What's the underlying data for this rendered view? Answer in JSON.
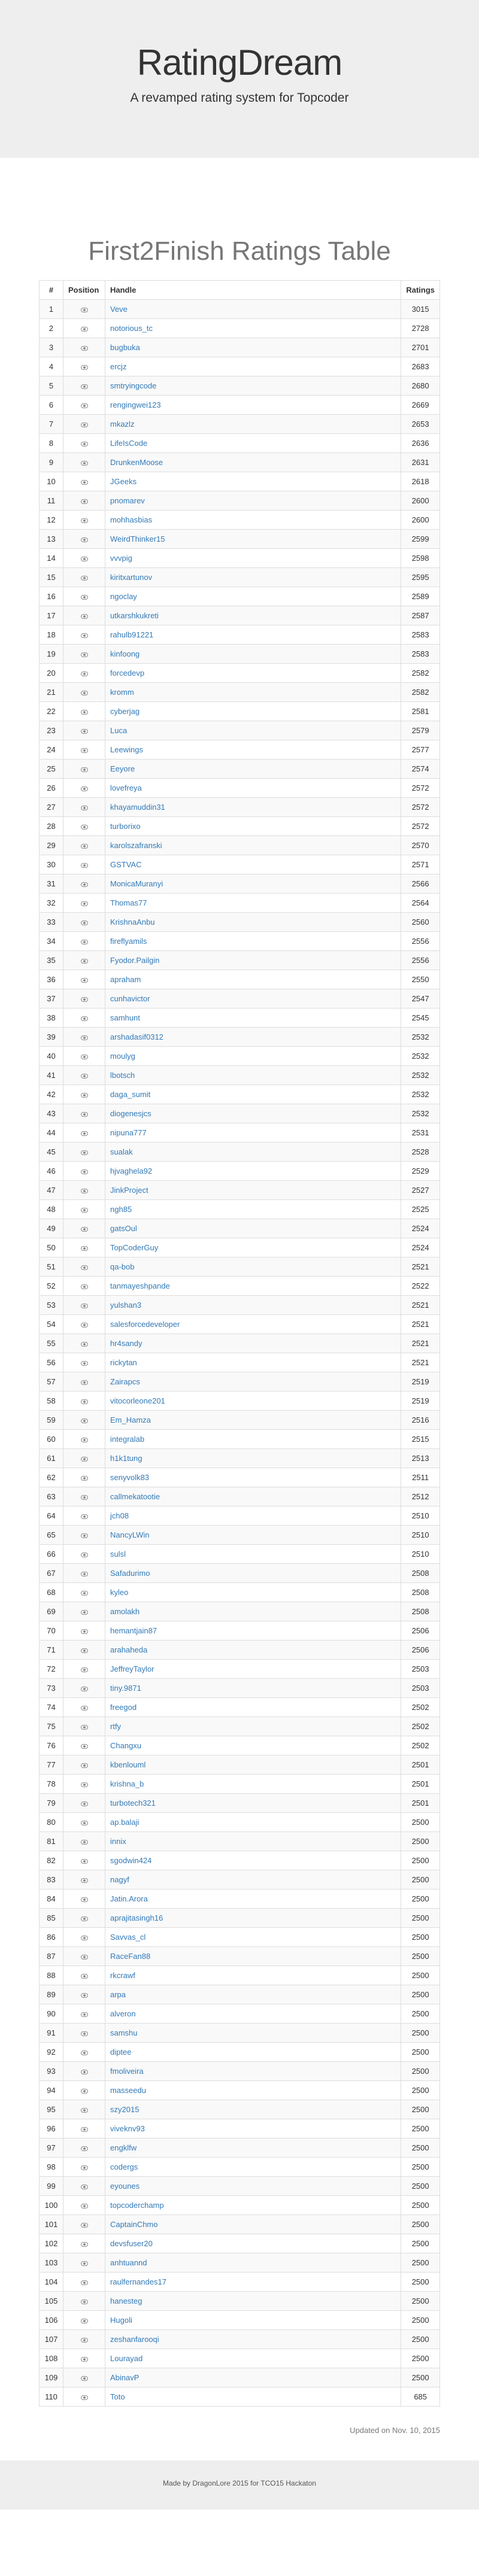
{
  "header": {
    "title": "RatingDream",
    "subtitle": "A revamped rating system for Topcoder"
  },
  "table": {
    "title": "First2Finish Ratings Table",
    "columns": [
      "#",
      "Position",
      "Handle",
      "Ratings"
    ],
    "rows": [
      {
        "n": "1",
        "handle": "Veve",
        "rating": "3015"
      },
      {
        "n": "2",
        "handle": "notorious_tc",
        "rating": "2728"
      },
      {
        "n": "3",
        "handle": "bugbuka",
        "rating": "2701"
      },
      {
        "n": "4",
        "handle": "ercjz",
        "rating": "2683"
      },
      {
        "n": "5",
        "handle": "smtryingcode",
        "rating": "2680"
      },
      {
        "n": "6",
        "handle": "rengingwei123",
        "rating": "2669"
      },
      {
        "n": "7",
        "handle": "mkazlz",
        "rating": "2653"
      },
      {
        "n": "8",
        "handle": "LifeIsCode",
        "rating": "2636"
      },
      {
        "n": "9",
        "handle": "DrunkenMoose",
        "rating": "2631"
      },
      {
        "n": "10",
        "handle": "JGeeks",
        "rating": "2618"
      },
      {
        "n": "11",
        "handle": "pnomarev",
        "rating": "2600"
      },
      {
        "n": "12",
        "handle": "mohhasbias",
        "rating": "2600"
      },
      {
        "n": "13",
        "handle": "WeirdThinker15",
        "rating": "2599"
      },
      {
        "n": "14",
        "handle": "vvvpig",
        "rating": "2598"
      },
      {
        "n": "15",
        "handle": "kiritxartunov",
        "rating": "2595"
      },
      {
        "n": "16",
        "handle": "ngoclay",
        "rating": "2589"
      },
      {
        "n": "17",
        "handle": "utkarshkukreti",
        "rating": "2587"
      },
      {
        "n": "18",
        "handle": "rahulb91221",
        "rating": "2583"
      },
      {
        "n": "19",
        "handle": "kinfoong",
        "rating": "2583"
      },
      {
        "n": "20",
        "handle": "forcedevp",
        "rating": "2582"
      },
      {
        "n": "21",
        "handle": "kromm",
        "rating": "2582"
      },
      {
        "n": "22",
        "handle": "cyberjag",
        "rating": "2581"
      },
      {
        "n": "23",
        "handle": "Luca",
        "rating": "2579"
      },
      {
        "n": "24",
        "handle": "Leewings",
        "rating": "2577"
      },
      {
        "n": "25",
        "handle": "Eeyore",
        "rating": "2574"
      },
      {
        "n": "26",
        "handle": "lovefreya",
        "rating": "2572"
      },
      {
        "n": "27",
        "handle": "khayamuddin31",
        "rating": "2572"
      },
      {
        "n": "28",
        "handle": "turborixo",
        "rating": "2572"
      },
      {
        "n": "29",
        "handle": "karolszafranski",
        "rating": "2570"
      },
      {
        "n": "30",
        "handle": "GSTVAC",
        "rating": "2571"
      },
      {
        "n": "31",
        "handle": "MonicaMuranyi",
        "rating": "2566"
      },
      {
        "n": "32",
        "handle": "Thomas77",
        "rating": "2564"
      },
      {
        "n": "33",
        "handle": "KrishnaAnbu",
        "rating": "2560"
      },
      {
        "n": "34",
        "handle": "fireflyamils",
        "rating": "2556"
      },
      {
        "n": "35",
        "handle": "Fyodor.Pailgin",
        "rating": "2556"
      },
      {
        "n": "36",
        "handle": "apraham",
        "rating": "2550"
      },
      {
        "n": "37",
        "handle": "cunhavictor",
        "rating": "2547"
      },
      {
        "n": "38",
        "handle": "samhunt",
        "rating": "2545"
      },
      {
        "n": "39",
        "handle": "arshadasif0312",
        "rating": "2532"
      },
      {
        "n": "40",
        "handle": "moulyg",
        "rating": "2532"
      },
      {
        "n": "41",
        "handle": "lbotsch",
        "rating": "2532"
      },
      {
        "n": "42",
        "handle": "daga_sumit",
        "rating": "2532"
      },
      {
        "n": "43",
        "handle": "diogenesjcs",
        "rating": "2532"
      },
      {
        "n": "44",
        "handle": "nipuna777",
        "rating": "2531"
      },
      {
        "n": "45",
        "handle": "sualak",
        "rating": "2528"
      },
      {
        "n": "46",
        "handle": "hjvaghela92",
        "rating": "2529"
      },
      {
        "n": "47",
        "handle": "JinkProject",
        "rating": "2527"
      },
      {
        "n": "48",
        "handle": "ngh85",
        "rating": "2525"
      },
      {
        "n": "49",
        "handle": "gatsOul",
        "rating": "2524"
      },
      {
        "n": "50",
        "handle": "TopCoderGuy",
        "rating": "2524"
      },
      {
        "n": "51",
        "handle": "qa-bob",
        "rating": "2521"
      },
      {
        "n": "52",
        "handle": "tanmayeshpande",
        "rating": "2522"
      },
      {
        "n": "53",
        "handle": "yulshan3",
        "rating": "2521"
      },
      {
        "n": "54",
        "handle": "salesforcedeveloper",
        "rating": "2521"
      },
      {
        "n": "55",
        "handle": "hr4sandy",
        "rating": "2521"
      },
      {
        "n": "56",
        "handle": "rickytan",
        "rating": "2521"
      },
      {
        "n": "57",
        "handle": "Zairapcs",
        "rating": "2519"
      },
      {
        "n": "58",
        "handle": "vitocorleone201",
        "rating": "2519"
      },
      {
        "n": "59",
        "handle": "Em_Hamza",
        "rating": "2516"
      },
      {
        "n": "60",
        "handle": "integralab",
        "rating": "2515"
      },
      {
        "n": "61",
        "handle": "h1k1tung",
        "rating": "2513"
      },
      {
        "n": "62",
        "handle": "senyvolk83",
        "rating": "2511"
      },
      {
        "n": "63",
        "handle": "callmekatootie",
        "rating": "2512"
      },
      {
        "n": "64",
        "handle": "jch08",
        "rating": "2510"
      },
      {
        "n": "65",
        "handle": "NancyLWin",
        "rating": "2510"
      },
      {
        "n": "66",
        "handle": "sulsl",
        "rating": "2510"
      },
      {
        "n": "67",
        "handle": "Safadurimo",
        "rating": "2508"
      },
      {
        "n": "68",
        "handle": "kyleo",
        "rating": "2508"
      },
      {
        "n": "69",
        "handle": "amolakh",
        "rating": "2508"
      },
      {
        "n": "70",
        "handle": "hemantjain87",
        "rating": "2506"
      },
      {
        "n": "71",
        "handle": "arahaheda",
        "rating": "2506"
      },
      {
        "n": "72",
        "handle": "JeffreyTaylor",
        "rating": "2503"
      },
      {
        "n": "73",
        "handle": "tiny.9871",
        "rating": "2503"
      },
      {
        "n": "74",
        "handle": "freegod",
        "rating": "2502"
      },
      {
        "n": "75",
        "handle": "rtfy",
        "rating": "2502"
      },
      {
        "n": "76",
        "handle": "Changxu",
        "rating": "2502"
      },
      {
        "n": "77",
        "handle": "kbenlouml",
        "rating": "2501"
      },
      {
        "n": "78",
        "handle": "krishna_b",
        "rating": "2501"
      },
      {
        "n": "79",
        "handle": "turbotech321",
        "rating": "2501"
      },
      {
        "n": "80",
        "handle": "ap.balaji",
        "rating": "2500"
      },
      {
        "n": "81",
        "handle": "innix",
        "rating": "2500"
      },
      {
        "n": "82",
        "handle": "sgodwin424",
        "rating": "2500"
      },
      {
        "n": "83",
        "handle": "nagyf",
        "rating": "2500"
      },
      {
        "n": "84",
        "handle": "Jatin.Arora",
        "rating": "2500"
      },
      {
        "n": "85",
        "handle": "aprajitasingh16",
        "rating": "2500"
      },
      {
        "n": "86",
        "handle": "Savvas_cl",
        "rating": "2500"
      },
      {
        "n": "87",
        "handle": "RaceFan88",
        "rating": "2500"
      },
      {
        "n": "88",
        "handle": "rkcrawf",
        "rating": "2500"
      },
      {
        "n": "89",
        "handle": "arpa",
        "rating": "2500"
      },
      {
        "n": "90",
        "handle": "alveron",
        "rating": "2500"
      },
      {
        "n": "91",
        "handle": "samshu",
        "rating": "2500"
      },
      {
        "n": "92",
        "handle": "diptee",
        "rating": "2500"
      },
      {
        "n": "93",
        "handle": "fmoliveira",
        "rating": "2500"
      },
      {
        "n": "94",
        "handle": "masseedu",
        "rating": "2500"
      },
      {
        "n": "95",
        "handle": "szy2015",
        "rating": "2500"
      },
      {
        "n": "96",
        "handle": "viveknv93",
        "rating": "2500"
      },
      {
        "n": "97",
        "handle": "engklfw",
        "rating": "2500"
      },
      {
        "n": "98",
        "handle": "codergs",
        "rating": "2500"
      },
      {
        "n": "99",
        "handle": "eyounes",
        "rating": "2500"
      },
      {
        "n": "100",
        "handle": "topcoderchamp",
        "rating": "2500"
      },
      {
        "n": "101",
        "handle": "CaptainChmo",
        "rating": "2500"
      },
      {
        "n": "102",
        "handle": "devsfuser20",
        "rating": "2500"
      },
      {
        "n": "103",
        "handle": "anhtuannd",
        "rating": "2500"
      },
      {
        "n": "104",
        "handle": "raulfernandes17",
        "rating": "2500"
      },
      {
        "n": "105",
        "handle": "hanesteg",
        "rating": "2500"
      },
      {
        "n": "106",
        "handle": "Hugoli",
        "rating": "2500"
      },
      {
        "n": "107",
        "handle": "zeshanfarooqi",
        "rating": "2500"
      },
      {
        "n": "108",
        "handle": "Lourayad",
        "rating": "2500"
      },
      {
        "n": "109",
        "handle": "AbinavP",
        "rating": "2500"
      },
      {
        "n": "110",
        "handle": "Toto",
        "rating": "685"
      }
    ]
  },
  "updated": "Updated on Nov. 10, 2015",
  "footer": "Made by DragonLore 2015 for TCO15 Hackaton",
  "icons": {
    "position": "eye-icon"
  },
  "colors": {
    "link": "#337ab7",
    "jumbotron": "#eeeeee",
    "title": "#777777"
  }
}
